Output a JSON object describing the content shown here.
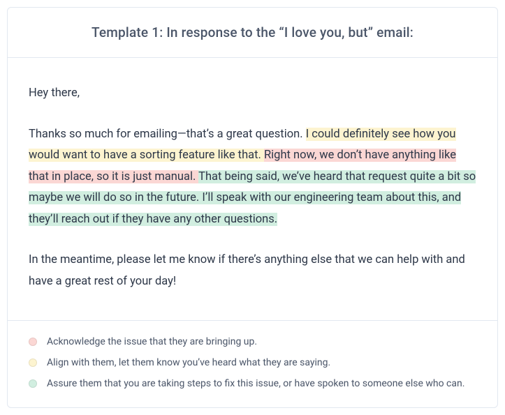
{
  "header": {
    "title": "Template 1: In response to the “I love you, but” email:"
  },
  "body": {
    "greeting": "Hey there,",
    "para1_plain_start": "Thanks so much for emailing—that’s a great question. ",
    "para1_yellow": "I could definitely see how you would want to have a sorting feature like that. ",
    "para1_red": "Right now, we don’t have anything like that in place, so it is just manual. ",
    "para1_green": "That being said, we’ve heard that request quite a bit so maybe we will do so in the future. I’ll speak with our engineering team about this, and they’ll reach out if they have any other questions.",
    "para2": "In the meantime, please let me know if there’s anything else that we can help with and have a great rest of your day!"
  },
  "legend": {
    "items": [
      {
        "color": "red",
        "text": "Acknowledge the issue that they are bringing up."
      },
      {
        "color": "yellow",
        "text": "Align with them, let them know you’ve heard what they are saying."
      },
      {
        "color": "green",
        "text": "Assure them that you are taking steps to fix this issue, or have spoken to someone else who can."
      }
    ]
  }
}
